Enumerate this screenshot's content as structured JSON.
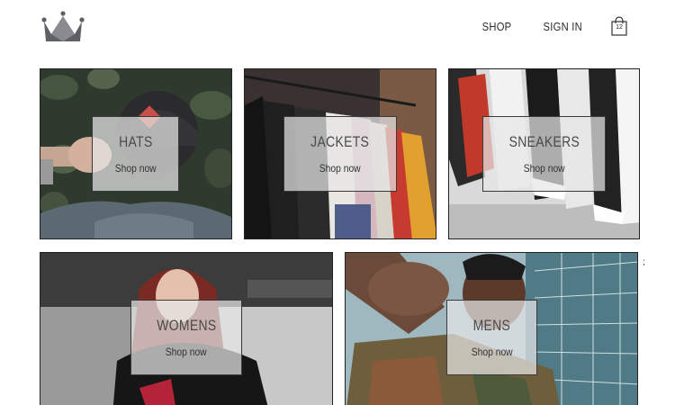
{
  "header": {
    "logo_icon": "crown-icon",
    "nav": {
      "shop_label": "SHOP",
      "signin_label": "SIGN IN"
    },
    "cart": {
      "icon": "shopping-bag-icon",
      "count": "12"
    }
  },
  "categories": [
    {
      "title": "HATS",
      "subtitle": "Shop now"
    },
    {
      "title": "JACKETS",
      "subtitle": "Shop now"
    },
    {
      "title": "SNEAKERS",
      "subtitle": "Shop now"
    },
    {
      "title": "WOMENS",
      "subtitle": "Shop now"
    },
    {
      "title": "MENS",
      "subtitle": "Shop now"
    }
  ],
  "stray_text": ";",
  "colors": {
    "accent_text": "#4a4a4a",
    "box_fill": "#e6e6e6",
    "border": "#222222"
  }
}
